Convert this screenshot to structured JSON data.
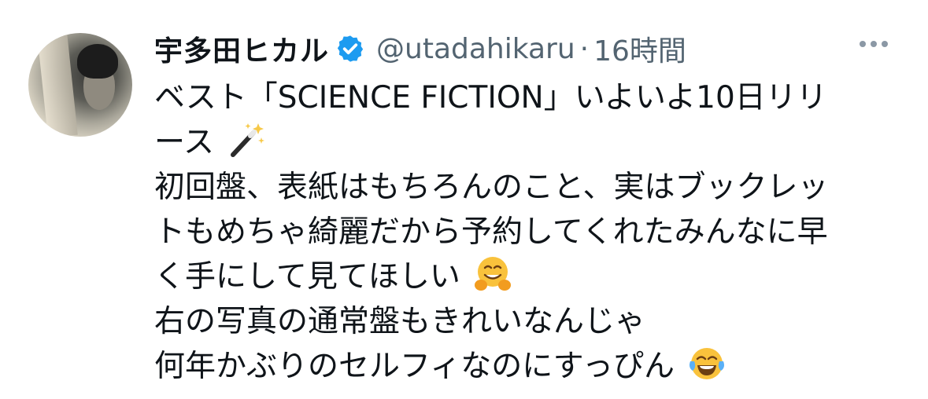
{
  "tweet": {
    "display_name": "宇多田ヒカル",
    "handle": "@utadahikaru",
    "separator": "·",
    "timestamp": "16時間",
    "more_icon": "ellipsis-icon",
    "verified_icon": "verified-badge-icon",
    "verified_color": "#1d9bf0",
    "lines": [
      "ベスト「SCIENCE FICTION」いよいよ10日リリ",
      "ース",
      "初回盤、表紙はもちろんのこと、実はブックレッ",
      "トもめちゃ綺麗だから予約してくれたみんなに早",
      "く手にして見てほしい",
      "右の写真の通常盤もきれいなんじゃ",
      "何年かぶりのセルフィなのにすっぴん"
    ],
    "emojis": {
      "magic_wand": "magic-wand-emoji",
      "hugging_face": "hugging-face-emoji",
      "tears_of_joy": "face-with-tears-of-joy-emoji"
    }
  }
}
